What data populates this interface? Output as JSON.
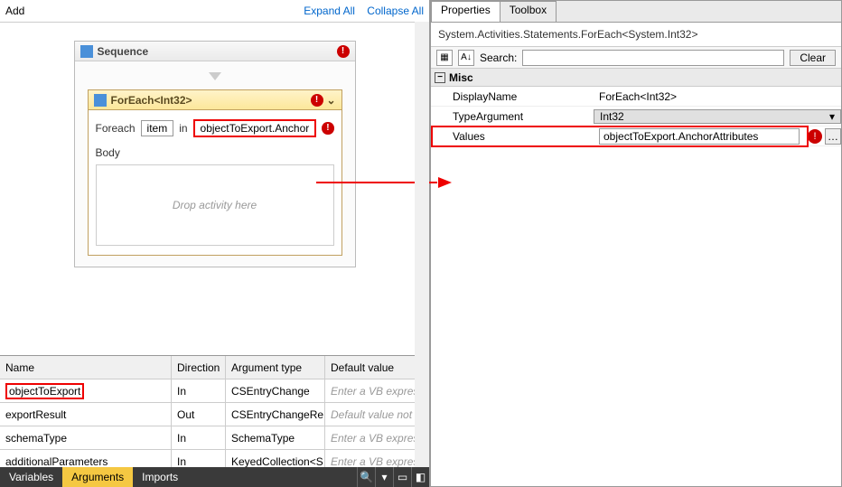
{
  "topbar": {
    "add": "Add",
    "expand": "Expand All",
    "collapse": "Collapse All"
  },
  "sequence": {
    "title": "Sequence"
  },
  "foreach": {
    "title": "ForEach<Int32>",
    "foreach_label": "Foreach",
    "item_var": "item",
    "in_label": "in",
    "in_expr": "objectToExport.Anchor",
    "body_label": "Body",
    "drop_hint": "Drop activity here"
  },
  "argsHeader": {
    "name": "Name",
    "direction": "Direction",
    "argtype": "Argument type",
    "defval": "Default value"
  },
  "args": [
    {
      "name": "objectToExport",
      "direction": "In",
      "type": "CSEntryChange",
      "def": "Enter a VB expres",
      "hl": true
    },
    {
      "name": "exportResult",
      "direction": "Out",
      "type": "CSEntryChangeRe",
      "def": "Default value not su",
      "hl": false
    },
    {
      "name": "schemaType",
      "direction": "In",
      "type": "SchemaType",
      "def": "Enter a VB expres",
      "hl": false
    },
    {
      "name": "additionalParameters",
      "direction": "In",
      "type": "KeyedCollection<S",
      "def": "Enter a VB expres",
      "hl": false
    }
  ],
  "btabs": {
    "variables": "Variables",
    "arguments": "Arguments",
    "imports": "Imports"
  },
  "rpTabs": {
    "properties": "Properties",
    "toolbox": "Toolbox"
  },
  "propType": "System.Activities.Statements.ForEach<System.Int32>",
  "propToolbar": {
    "search_label": "Search:",
    "clear": "Clear"
  },
  "propGroup": "Misc",
  "props": {
    "displayName": {
      "label": "DisplayName",
      "value": "ForEach<Int32>"
    },
    "typeArgument": {
      "label": "TypeArgument",
      "value": "Int32"
    },
    "values": {
      "label": "Values",
      "value": "objectToExport.AnchorAttributes"
    }
  }
}
